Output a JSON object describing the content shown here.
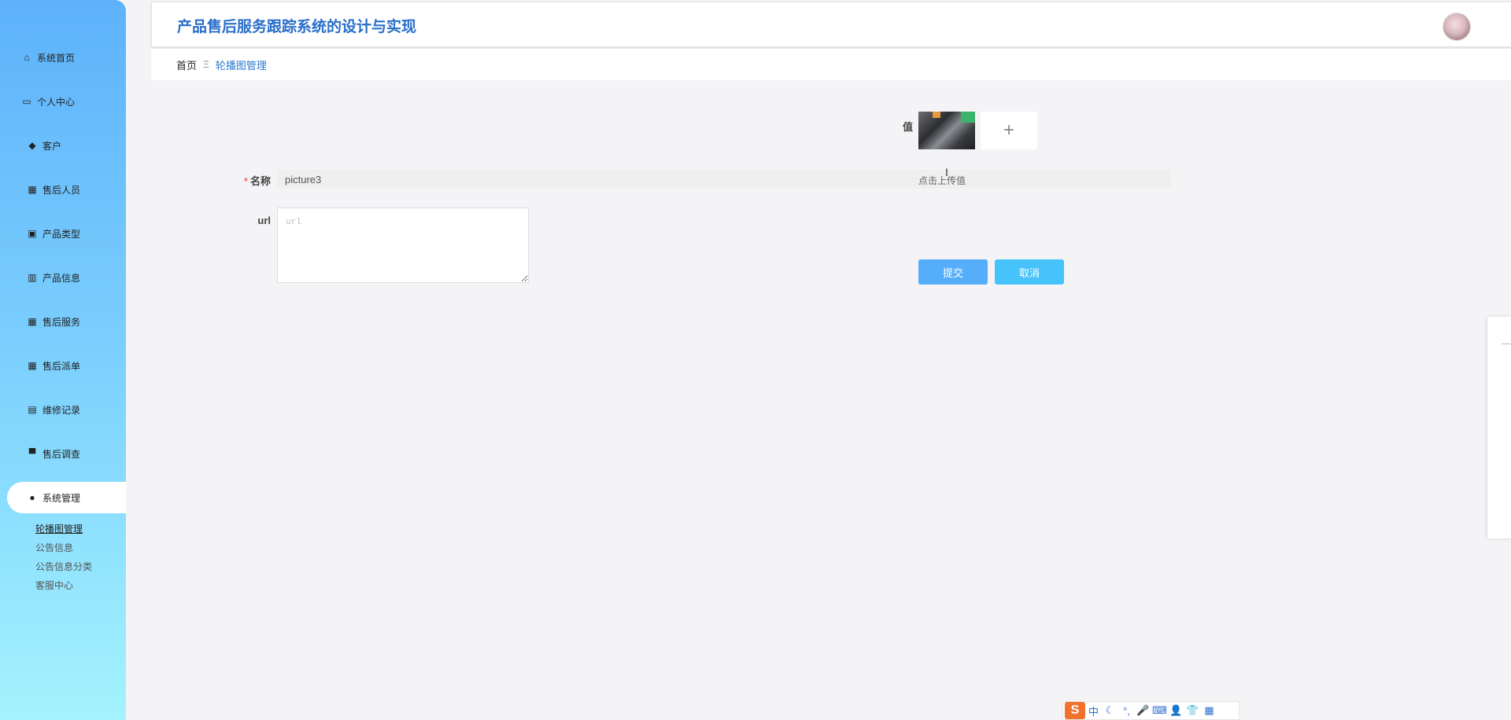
{
  "app": {
    "title": "产品售后服务跟踪系统的设计与实现"
  },
  "sidebar": {
    "items": [
      {
        "label": "系统首页",
        "icon": "⌂"
      },
      {
        "label": "个人中心",
        "icon": "▭"
      },
      {
        "label": "客户",
        "icon": "◆"
      },
      {
        "label": "售后人员",
        "icon": "▦"
      },
      {
        "label": "产品类型",
        "icon": "▣"
      },
      {
        "label": "产品信息",
        "icon": "▥"
      },
      {
        "label": "售后服务",
        "icon": "▦"
      },
      {
        "label": "售后派单",
        "icon": "▦"
      },
      {
        "label": "维修记录",
        "icon": "▤"
      },
      {
        "label": "售后调查",
        "icon": "▀"
      },
      {
        "label": "系统管理",
        "icon": "●"
      }
    ],
    "submenu": [
      "轮播图管理",
      "公告信息",
      "公告信息分类",
      "客服中心"
    ]
  },
  "breadcrumb": {
    "home": "首页",
    "separator": "Ξ",
    "current": "轮播图管理"
  },
  "form": {
    "name_label": "名称",
    "name_required_mark": "*",
    "name_value": "picture3",
    "url_label": "url",
    "url_placeholder": "url",
    "value_label": "值",
    "upload_plus": "+",
    "upload_hint": "点击上传值",
    "submit_label": "提交",
    "cancel_label": "取消"
  },
  "ime": {
    "logo": "S",
    "icons": [
      "中",
      "☾",
      "°,",
      "🎤",
      "⌨",
      "👤",
      "👕",
      "▦"
    ]
  },
  "colors": {
    "sidebar_top": "#5db2fb",
    "sidebar_bottom": "#a4f3fe",
    "title": "#2a6fc9",
    "submit": "#56aefb",
    "cancel": "#47c3fb"
  }
}
